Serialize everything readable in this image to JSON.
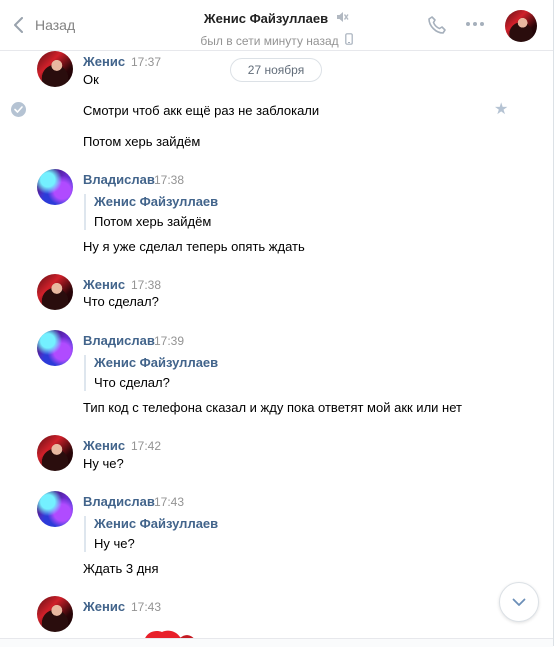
{
  "header": {
    "back_label": "Назад",
    "title": "Женис Файзуллаев",
    "status": "был в сети минуту назад"
  },
  "date_separator": "27 ноября",
  "messages": [
    {
      "author": "Женис",
      "time": "17:37",
      "lines": [
        "Ок",
        "Смотри чтоб акк ещё раз не заблокали",
        "Потом херь зайдём"
      ]
    },
    {
      "author": "Владислав",
      "time": "17:38",
      "quote": {
        "author": "Женис Файзуллаев",
        "text": "Потом херь зайдём"
      },
      "text": "Ну я уже сделал теперь опять ждать"
    },
    {
      "author": "Женис",
      "time": "17:38",
      "text": "Что сделал?"
    },
    {
      "author": "Владислав",
      "time": "17:39",
      "quote": {
        "author": "Женис Файзуллаев",
        "text": "Что сделал?"
      },
      "text": "Тип код с телефона сказал и жду пока ответят мой акк или нет"
    },
    {
      "author": "Женис",
      "time": "17:42",
      "text": "Ну че?"
    },
    {
      "author": "Владислав",
      "time": "17:43",
      "quote": {
        "author": "Женис Файзуллаев",
        "text": "Ну че?"
      },
      "text": "Ждать 3 дня"
    },
    {
      "author": "Женис",
      "time": "17:43"
    }
  ],
  "icons": {
    "back": "chevron-left-icon",
    "mute": "muted-speaker-icon",
    "mobile": "mobile-phone-icon",
    "call": "phone-icon",
    "more": "more-dots-icon",
    "read": "check-icon",
    "favorite": "star-icon",
    "scroll_down": "chevron-down-icon"
  },
  "colors": {
    "link": "#42648b",
    "muted_text": "#939393",
    "icon": "#a6b0bc",
    "border": "#dce1e6"
  }
}
